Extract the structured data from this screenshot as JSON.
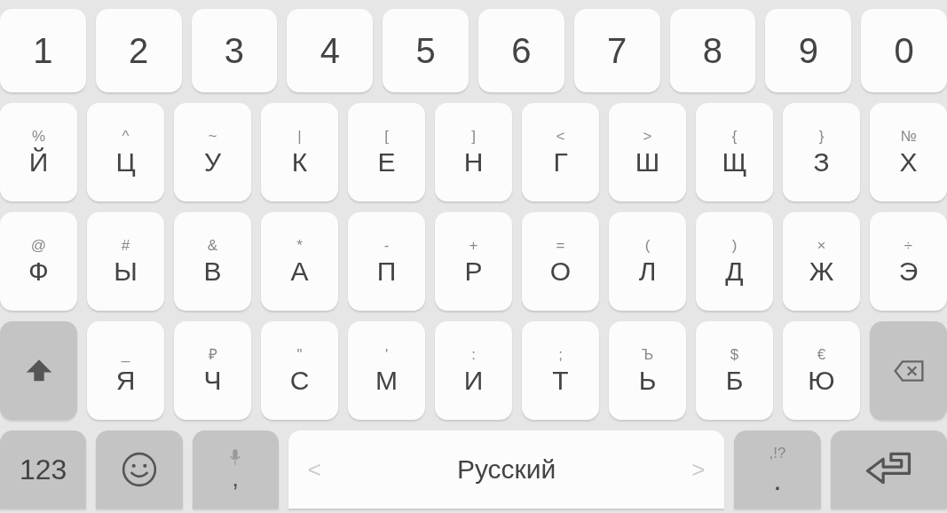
{
  "rows": [
    {
      "keys": [
        {
          "kind": "digit",
          "label": "1"
        },
        {
          "kind": "digit",
          "label": "2"
        },
        {
          "kind": "digit",
          "label": "3"
        },
        {
          "kind": "digit",
          "label": "4"
        },
        {
          "kind": "digit",
          "label": "5"
        },
        {
          "kind": "digit",
          "label": "6"
        },
        {
          "kind": "digit",
          "label": "7"
        },
        {
          "kind": "digit",
          "label": "8"
        },
        {
          "kind": "digit",
          "label": "9"
        },
        {
          "kind": "digit",
          "label": "0"
        }
      ]
    },
    {
      "keys": [
        {
          "kind": "letter",
          "label": "Й",
          "hint": "%"
        },
        {
          "kind": "letter",
          "label": "Ц",
          "hint": "^"
        },
        {
          "kind": "letter",
          "label": "У",
          "hint": "~"
        },
        {
          "kind": "letter",
          "label": "К",
          "hint": "|"
        },
        {
          "kind": "letter",
          "label": "Е",
          "hint": "["
        },
        {
          "kind": "letter",
          "label": "Н",
          "hint": "]"
        },
        {
          "kind": "letter",
          "label": "Г",
          "hint": "<"
        },
        {
          "kind": "letter",
          "label": "Ш",
          "hint": ">"
        },
        {
          "kind": "letter",
          "label": "Щ",
          "hint": "{"
        },
        {
          "kind": "letter",
          "label": "З",
          "hint": "}"
        },
        {
          "kind": "letter",
          "label": "Х",
          "hint": "№"
        }
      ]
    },
    {
      "keys": [
        {
          "kind": "letter",
          "label": "Ф",
          "hint": "@"
        },
        {
          "kind": "letter",
          "label": "Ы",
          "hint": "#"
        },
        {
          "kind": "letter",
          "label": "В",
          "hint": "&"
        },
        {
          "kind": "letter",
          "label": "А",
          "hint": "*"
        },
        {
          "kind": "letter",
          "label": "П",
          "hint": "-"
        },
        {
          "kind": "letter",
          "label": "Р",
          "hint": "+"
        },
        {
          "kind": "letter",
          "label": "О",
          "hint": "="
        },
        {
          "kind": "letter",
          "label": "Л",
          "hint": "("
        },
        {
          "kind": "letter",
          "label": "Д",
          "hint": ")"
        },
        {
          "kind": "letter",
          "label": "Ж",
          "hint": "×"
        },
        {
          "kind": "letter",
          "label": "Э",
          "hint": "÷"
        }
      ]
    },
    {
      "keys": [
        {
          "kind": "shift"
        },
        {
          "kind": "letter",
          "label": "Я",
          "hint": "_"
        },
        {
          "kind": "letter",
          "label": "Ч",
          "hint": "₽"
        },
        {
          "kind": "letter",
          "label": "С",
          "hint": "\""
        },
        {
          "kind": "letter",
          "label": "М",
          "hint": "'"
        },
        {
          "kind": "letter",
          "label": "И",
          "hint": ":"
        },
        {
          "kind": "letter",
          "label": "Т",
          "hint": ";"
        },
        {
          "kind": "letter",
          "label": "Ь",
          "hint": "Ъ"
        },
        {
          "kind": "letter",
          "label": "Б",
          "hint": "$"
        },
        {
          "kind": "letter",
          "label": "Ю",
          "hint": "€"
        },
        {
          "kind": "backspace"
        }
      ]
    },
    {
      "keys": [
        {
          "kind": "mode",
          "label": "123"
        },
        {
          "kind": "emoji"
        },
        {
          "kind": "mic",
          "label": ","
        },
        {
          "kind": "space",
          "label": "Русский",
          "left": "<",
          "right": ">"
        },
        {
          "kind": "punct",
          "label": ".",
          "hint": ",!?"
        },
        {
          "kind": "enter"
        }
      ]
    }
  ]
}
